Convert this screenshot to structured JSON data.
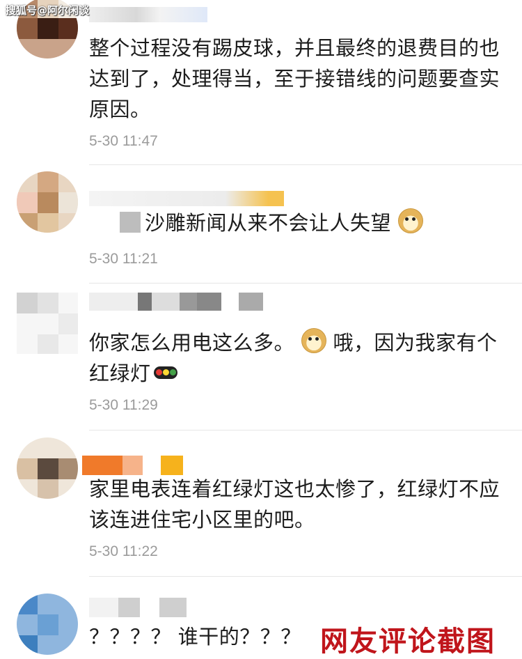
{
  "watermark": "搜狐号@阿尔闲谈",
  "stamp": "网友评论截图",
  "colors": {
    "time": "#9b9b9b",
    "stamp": "#c0151b",
    "divider": "#e6e6e6"
  },
  "comments": [
    {
      "text": "整个过程没有踢皮球，并且最终的退费目的也达到了，处理得当，至于接错线的问题要查实原因。",
      "time": "5-30 11:47"
    },
    {
      "text": "沙雕新闻从来不会让人失望",
      "emoji": "doge-icon",
      "time": "5-30 11:21"
    },
    {
      "text_a": "你家怎么用电这么多。",
      "text_b": "哦，因为我家有个红绿灯",
      "emoji": "doge-icon",
      "emoji2": "traffic-light-icon",
      "time": "5-30 11:29"
    },
    {
      "text": "家里电表连着红绿灯这也太惨了，红绿灯不应该连进住宅小区里的吧。",
      "time": "5-30 11:22"
    },
    {
      "text": "？？？？ 谁干的？？？"
    }
  ]
}
